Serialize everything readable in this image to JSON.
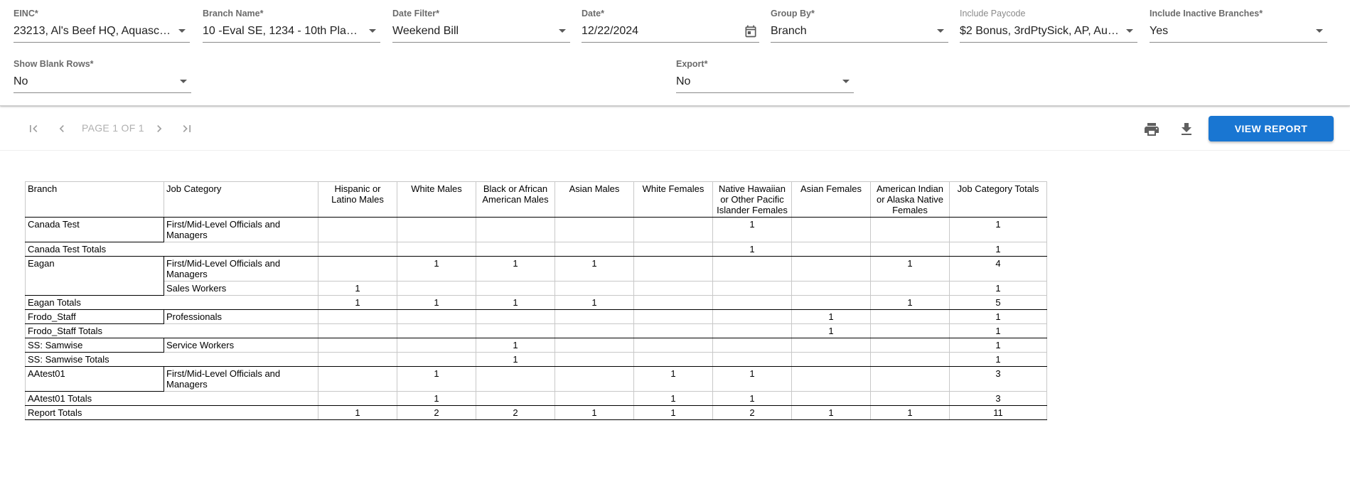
{
  "filters": {
    "einc": {
      "label": "EINC*",
      "value": "23213, Al's Beef HQ, Aquasca..."
    },
    "branch_name": {
      "label": "Branch Name*",
      "value": "10 -Eval SE, 1234 - 10th Plane..."
    },
    "date_filter": {
      "label": "Date Filter*",
      "value": "Weekend Bill"
    },
    "date": {
      "label": "Date*",
      "value": "12/22/2024"
    },
    "group_by": {
      "label": "Group By*",
      "value": "Branch"
    },
    "include_paycode": {
      "label": "Include Paycode",
      "value": "$2 Bonus, 3rdPtySick, AP, Auo..."
    },
    "include_inactive": {
      "label": "Include Inactive Branches*",
      "value": "Yes"
    },
    "show_blank_rows": {
      "label": "Show Blank Rows*",
      "value": "No"
    },
    "export": {
      "label": "Export*",
      "value": "No"
    }
  },
  "toolbar": {
    "page_text": "PAGE 1 OF 1",
    "view_report": "VIEW REPORT",
    "icons": [
      "first-page-icon",
      "prev-page-icon",
      "next-page-icon",
      "last-page-icon",
      "print-icon",
      "download-icon",
      "calendar-icon"
    ]
  },
  "report": {
    "headers": {
      "branch": "Branch",
      "job_category": "Job Category",
      "cols": [
        "Hispanic or Latino Males",
        "White Males",
        "Black or African American Males",
        "Asian Males",
        "White Females",
        "Native Hawaiian or Other Pacific Islander Females",
        "Asian Females",
        "American Indian or Alaska Native Females",
        "Job Category Totals"
      ]
    },
    "groups": [
      {
        "branch": "Canada Test",
        "rows": [
          {
            "category": "First/Mid-Level Officials and Managers",
            "values": [
              "",
              "",
              "",
              "",
              "",
              "1",
              "",
              "",
              "1"
            ]
          }
        ],
        "total_label": "Canada Test Totals",
        "totals": [
          "",
          "",
          "",
          "",
          "",
          "1",
          "",
          "",
          "1"
        ]
      },
      {
        "branch": "Eagan",
        "rows": [
          {
            "category": "First/Mid-Level Officials and Managers",
            "values": [
              "",
              "1",
              "1",
              "1",
              "",
              "",
              "",
              "1",
              "4"
            ]
          },
          {
            "category": "Sales Workers",
            "values": [
              "1",
              "",
              "",
              "",
              "",
              "",
              "",
              "",
              "1"
            ]
          }
        ],
        "total_label": "Eagan Totals",
        "totals": [
          "1",
          "1",
          "1",
          "1",
          "",
          "",
          "",
          "1",
          "5"
        ]
      },
      {
        "branch": "Frodo_Staff",
        "rows": [
          {
            "category": "Professionals",
            "values": [
              "",
              "",
              "",
              "",
              "",
              "",
              "1",
              "",
              "1"
            ]
          }
        ],
        "total_label": "Frodo_Staff Totals",
        "totals": [
          "",
          "",
          "",
          "",
          "",
          "",
          "1",
          "",
          "1"
        ]
      },
      {
        "branch": "SS: Samwise",
        "rows": [
          {
            "category": "Service Workers",
            "values": [
              "",
              "",
              "1",
              "",
              "",
              "",
              "",
              "",
              "1"
            ]
          }
        ],
        "total_label": "SS: Samwise Totals",
        "totals": [
          "",
          "",
          "1",
          "",
          "",
          "",
          "",
          "",
          "1"
        ]
      },
      {
        "branch": "AAtest01",
        "rows": [
          {
            "category": "First/Mid-Level Officials and Managers",
            "values": [
              "",
              "1",
              "",
              "",
              "1",
              "1",
              "",
              "",
              "3"
            ]
          }
        ],
        "total_label": "AAtest01 Totals",
        "totals": [
          "",
          "1",
          "",
          "",
          "1",
          "1",
          "",
          "",
          "3"
        ]
      }
    ],
    "grand_total_label": "Report Totals",
    "grand_totals": [
      "1",
      "2",
      "2",
      "1",
      "1",
      "2",
      "1",
      "1",
      "11"
    ]
  },
  "colors": {
    "primary": "#1976d2",
    "label_gray": "#5f6368",
    "disabled_gray": "#b0b0b0"
  }
}
